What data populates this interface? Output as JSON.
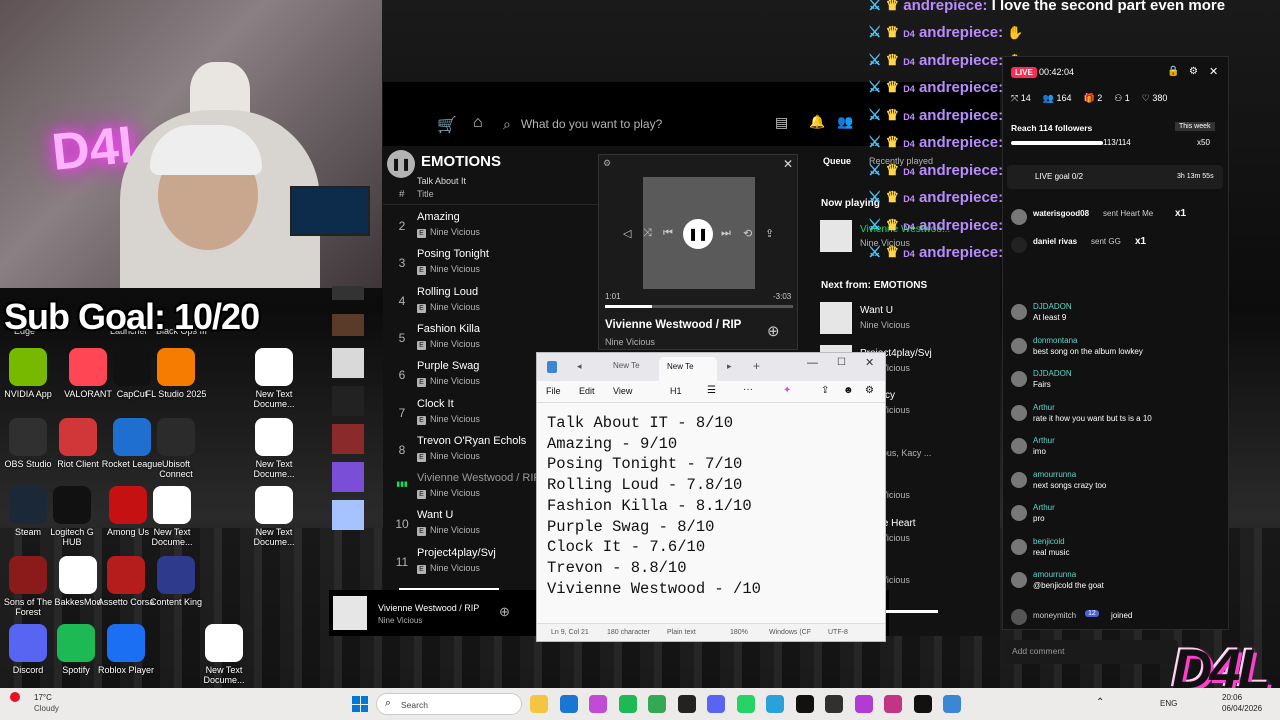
{
  "overlay": {
    "sub_goal": "Sub Goal: 10/20",
    "brand_logo": "D4L",
    "neon_sign": "D4L"
  },
  "desktop_icons": [
    {
      "label": "NVIDIA App",
      "color": "#76b900",
      "icon": "nvidia-icon"
    },
    {
      "label": "VALORANT",
      "color": "#ff4655",
      "icon": "valorant-icon"
    },
    {
      "label": "CapCut",
      "color": "#111111",
      "icon": "capcut-icon"
    },
    {
      "label": "FL Studio 2025",
      "color": "#f57c00",
      "icon": "fl-studio-icon"
    },
    {
      "label": "New Text Docume...",
      "color": "#ffffff",
      "icon": "text-document-icon"
    },
    {
      "label": "OBS Studio",
      "color": "#303030",
      "icon": "obs-icon"
    },
    {
      "label": "Riot Client",
      "color": "#d13639",
      "icon": "riot-client-icon"
    },
    {
      "label": "Rocket League",
      "color": "#1f6fd1",
      "icon": "rocket-league-icon"
    },
    {
      "label": "Ubisoft Connect",
      "color": "#2b2b2b",
      "icon": "ubisoft-icon"
    },
    {
      "label": "New Text Docume...",
      "color": "#ffffff",
      "icon": "text-document-icon"
    },
    {
      "label": "Steam",
      "color": "#1b2838",
      "icon": "steam-icon"
    },
    {
      "label": "Logitech G HUB",
      "color": "#111111",
      "icon": "logitech-icon"
    },
    {
      "label": "Among Us",
      "color": "#c51111",
      "icon": "among-us-icon"
    },
    {
      "label": "New Text Docume...",
      "color": "#ffffff",
      "icon": "text-document-icon"
    },
    {
      "label": "New Text Docume...",
      "color": "#ffffff",
      "icon": "text-document-icon"
    },
    {
      "label": "Sons of The Forest",
      "color": "#8b1a1a",
      "icon": "sons-forest-icon"
    },
    {
      "label": "BakkesMod",
      "color": "#ffffff",
      "icon": "bakkesmod-icon"
    },
    {
      "label": "Assetto Corsa",
      "color": "#b51c1c",
      "icon": "assetto-corsa-icon"
    },
    {
      "label": "Content King",
      "color": "#2e3a8c",
      "icon": "content-king-icon"
    },
    {
      "label": "Discord",
      "color": "#5865f2",
      "icon": "discord-icon"
    },
    {
      "label": "Spotify",
      "color": "#1db954",
      "icon": "spotify-icon"
    },
    {
      "label": "Roblox Player",
      "color": "#1b6ff2",
      "icon": "roblox-icon"
    },
    {
      "label": "New Text Docume...",
      "color": "#ffffff",
      "icon": "text-document-icon"
    }
  ],
  "top_partial_labels": [
    "Edge",
    "Launcher",
    "Black Ops III"
  ],
  "spotify": {
    "search_placeholder": "What do you want to play?",
    "playlist_title": "EMOTIONS",
    "scrolled_title": "Talk About It",
    "col_hash": "#",
    "col_title": "Title",
    "tracks": [
      {
        "num": "2",
        "title": "Amazing",
        "artist": "Nine Vicious"
      },
      {
        "num": "3",
        "title": "Posing Tonight",
        "artist": "Nine Vicious"
      },
      {
        "num": "4",
        "title": "Rolling Loud",
        "artist": "Nine Vicious"
      },
      {
        "num": "5",
        "title": "Fashion Killa",
        "artist": "Nine Vicious"
      },
      {
        "num": "6",
        "title": "Purple Swag",
        "artist": "Nine Vicious"
      },
      {
        "num": "7",
        "title": "Clock It",
        "artist": "Nine Vicious"
      },
      {
        "num": "8",
        "title": "Trevon O'Ryan Echols",
        "artist": "Nine Vicious"
      },
      {
        "num": "",
        "title": "Vivienne Westwood / RIP",
        "artist": "Nine Vicious",
        "playing": true
      },
      {
        "num": "10",
        "title": "Want U",
        "artist": "Nine Vicious"
      },
      {
        "num": "11",
        "title": "Project4play/Svj",
        "artist": "Nine Vicious"
      }
    ],
    "queue_tab": "Queue",
    "recent_tab": "Recently played",
    "now_playing_header": "Now playing",
    "now_playing_title": "Vivienne Westwoo...",
    "now_playing_artist": "Nine Vicious",
    "next_from": "Next from: EMOTIONS",
    "queue": [
      {
        "title": "Want U",
        "artist": "Nine Vicious"
      },
      {
        "title": "Project4play/Svj",
        "artist": "Nine Vicious"
      },
      {
        "title": "Ecstacy",
        "artist": "Nine Vicious"
      },
      {
        "title": "et Hill",
        "artist": "e Vicious, Kacy ..."
      },
      {
        "title": "Det",
        "artist": "Nine Vicious"
      },
      {
        "title": "Whole Heart",
        "artist": "Nine Vicious"
      },
      {
        "title": "",
        "artist": "Nine Vicious"
      }
    ],
    "bottom_title": "Vivienne Westwood / RIP",
    "bottom_artist": "Nine Vicious"
  },
  "miniplayer": {
    "title": "Vivienne Westwood / RIP",
    "artist": "Nine Vicious",
    "elapsed": "1:01",
    "remaining": "-3:03",
    "progress": 0.25
  },
  "notepad": {
    "tabs": [
      "New Te",
      "New Te"
    ],
    "menu": [
      "File",
      "Edit",
      "View"
    ],
    "heading": "H1",
    "lines": [
      "Talk About IT - 8/10",
      "Amazing - 9/10",
      "Posing Tonight - 7/10",
      "Rolling Loud - 7.8/10",
      "Fashion Killa - 8.1/10",
      "Purple Swag - 8/10",
      "Clock It - 7.6/10",
      "Trevon - 8.8/10",
      "Vivienne Westwood - /10"
    ],
    "status": {
      "position": "Ln 9, Col 21",
      "chars": "180 character",
      "format": "Plain text",
      "zoom": "180%",
      "eol": "Windows (CF",
      "encoding": "UTF-8"
    }
  },
  "twitch_chat": {
    "first_message": "I love the second part even more",
    "lines": [
      "andrepiece:",
      "andrepiece:",
      "andrepiece:",
      "andrepiece:",
      "andrepiece:",
      "andrepiece:",
      "andrepiece:",
      "andrepiece:",
      "andrepiece:",
      "andrepiece:"
    ],
    "badge": "D4"
  },
  "tiktok_live": {
    "live_badge": "LIVE",
    "timer": "00:42:04",
    "stats": [
      "14",
      "164",
      "2",
      "1",
      "380"
    ],
    "goal_text": "Reach 114 followers",
    "goal_period": "This week",
    "goal_progress": "113/114",
    "goal_multiplier": "x50",
    "live_goal": "LIVE goal 0/2",
    "live_goal_time": "3h 13m 55s",
    "gift_1_user": "waterisgood08",
    "gift_1_text": "sent Heart Me",
    "gift_1_count": "x1",
    "gift_2_user": "daniel rivas",
    "gift_2_text": "sent GG",
    "gift_2_count": "x1",
    "messages": [
      {
        "user": "DJDADON",
        "text": "At least 9"
      },
      {
        "user": "donmontana",
        "text": "best song on the album lowkey"
      },
      {
        "user": "DJDADON",
        "text": "Fairs"
      },
      {
        "user": "Arthur",
        "text": "rate it how you want but ts is a 10"
      },
      {
        "user": "Arthur",
        "text": "imo"
      },
      {
        "user": "amourrunna",
        "text": "next songs crazy too"
      },
      {
        "user": "Arthur",
        "text": "pro"
      },
      {
        "user": "benjicold",
        "text": "real music"
      },
      {
        "user": "amourrunna",
        "text": "@benjicold the goat"
      }
    ],
    "join_user": "moneymitch",
    "join_level": "12",
    "join_text": "joined",
    "comment_placeholder": "Add comment"
  },
  "taskbar": {
    "weather_temp": "17°C",
    "weather_text": "Cloudy",
    "search_placeholder": "Search",
    "language": "ENG",
    "time": "20:06",
    "date": "06/04/2026"
  }
}
